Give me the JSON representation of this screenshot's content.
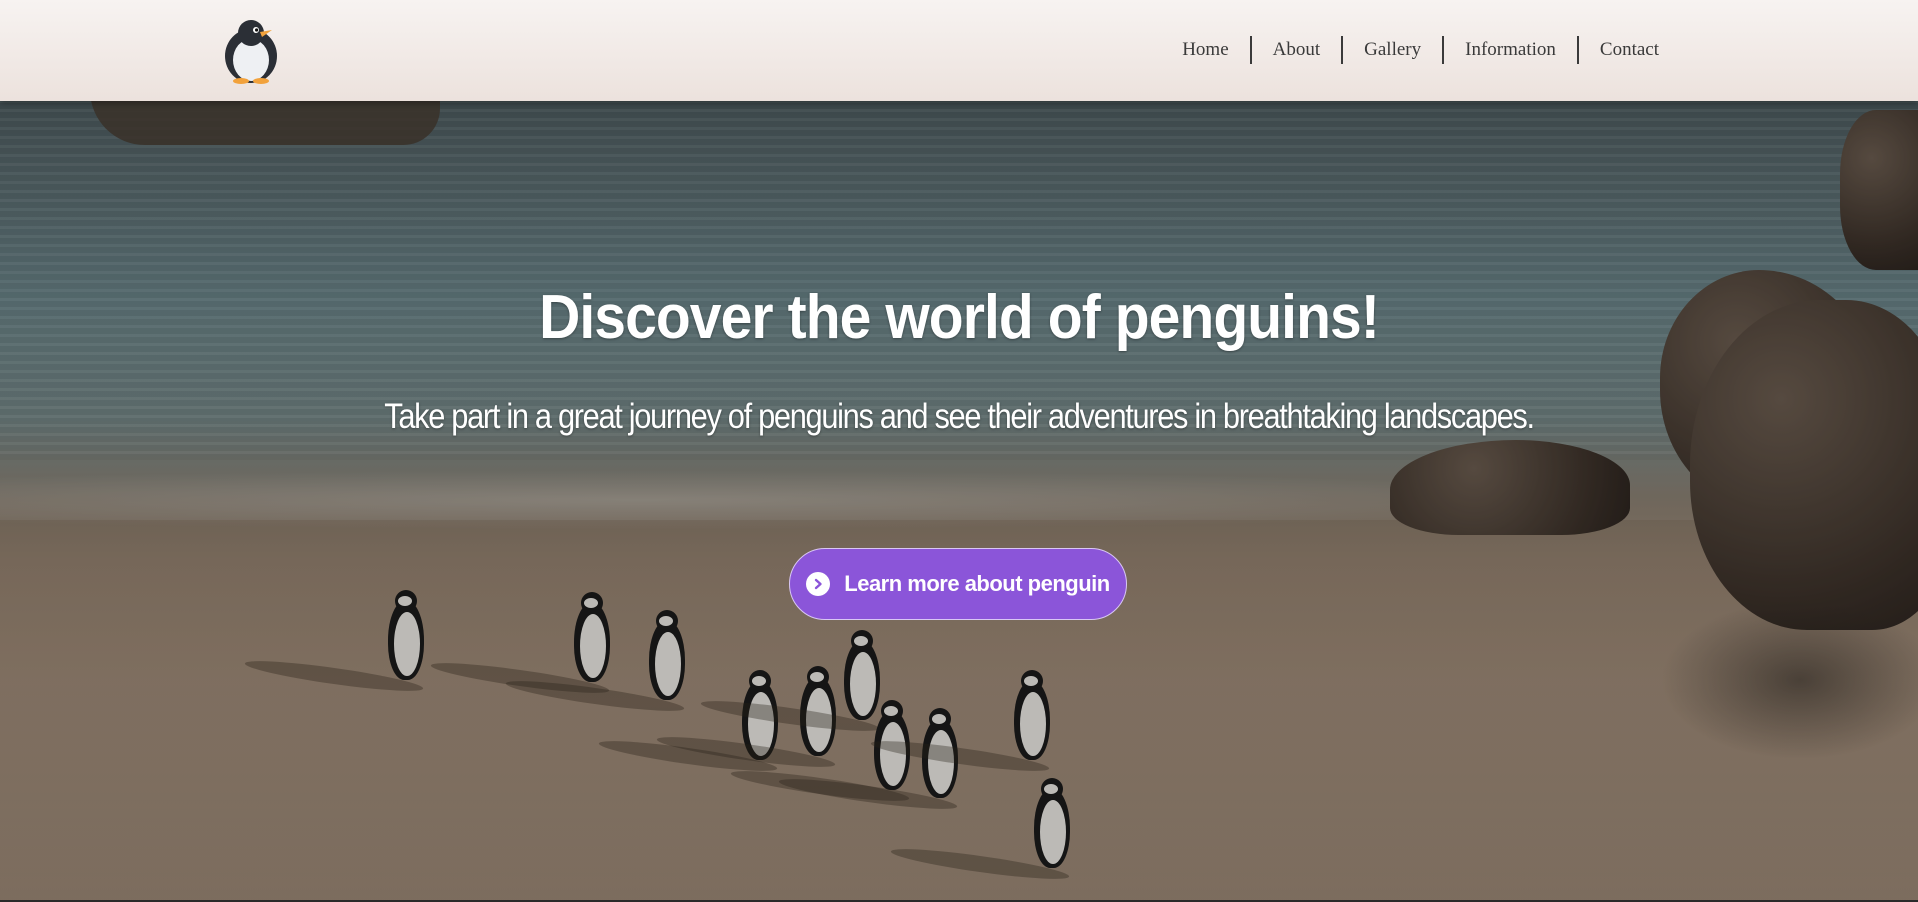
{
  "header": {
    "logo_icon": "penguin-logo",
    "nav": {
      "home": "Home",
      "about": "About",
      "gallery": "Gallery",
      "information": "Information",
      "contact": "Contact"
    }
  },
  "hero": {
    "title": "Discover the world of penguins!",
    "subtitle": "Take part in a great journey of penguins and see their adventures in breathtaking landscapes.",
    "cta": {
      "label": "Learn more about penguin",
      "icon": "chevron-right-circle-icon",
      "color": "#8b55d9"
    },
    "background": "beach with penguins"
  },
  "colors": {
    "header_bg": "#f3ece8",
    "nav_text": "#3a3a3a",
    "hero_text": "#ffffff",
    "accent": "#8b55d9"
  }
}
